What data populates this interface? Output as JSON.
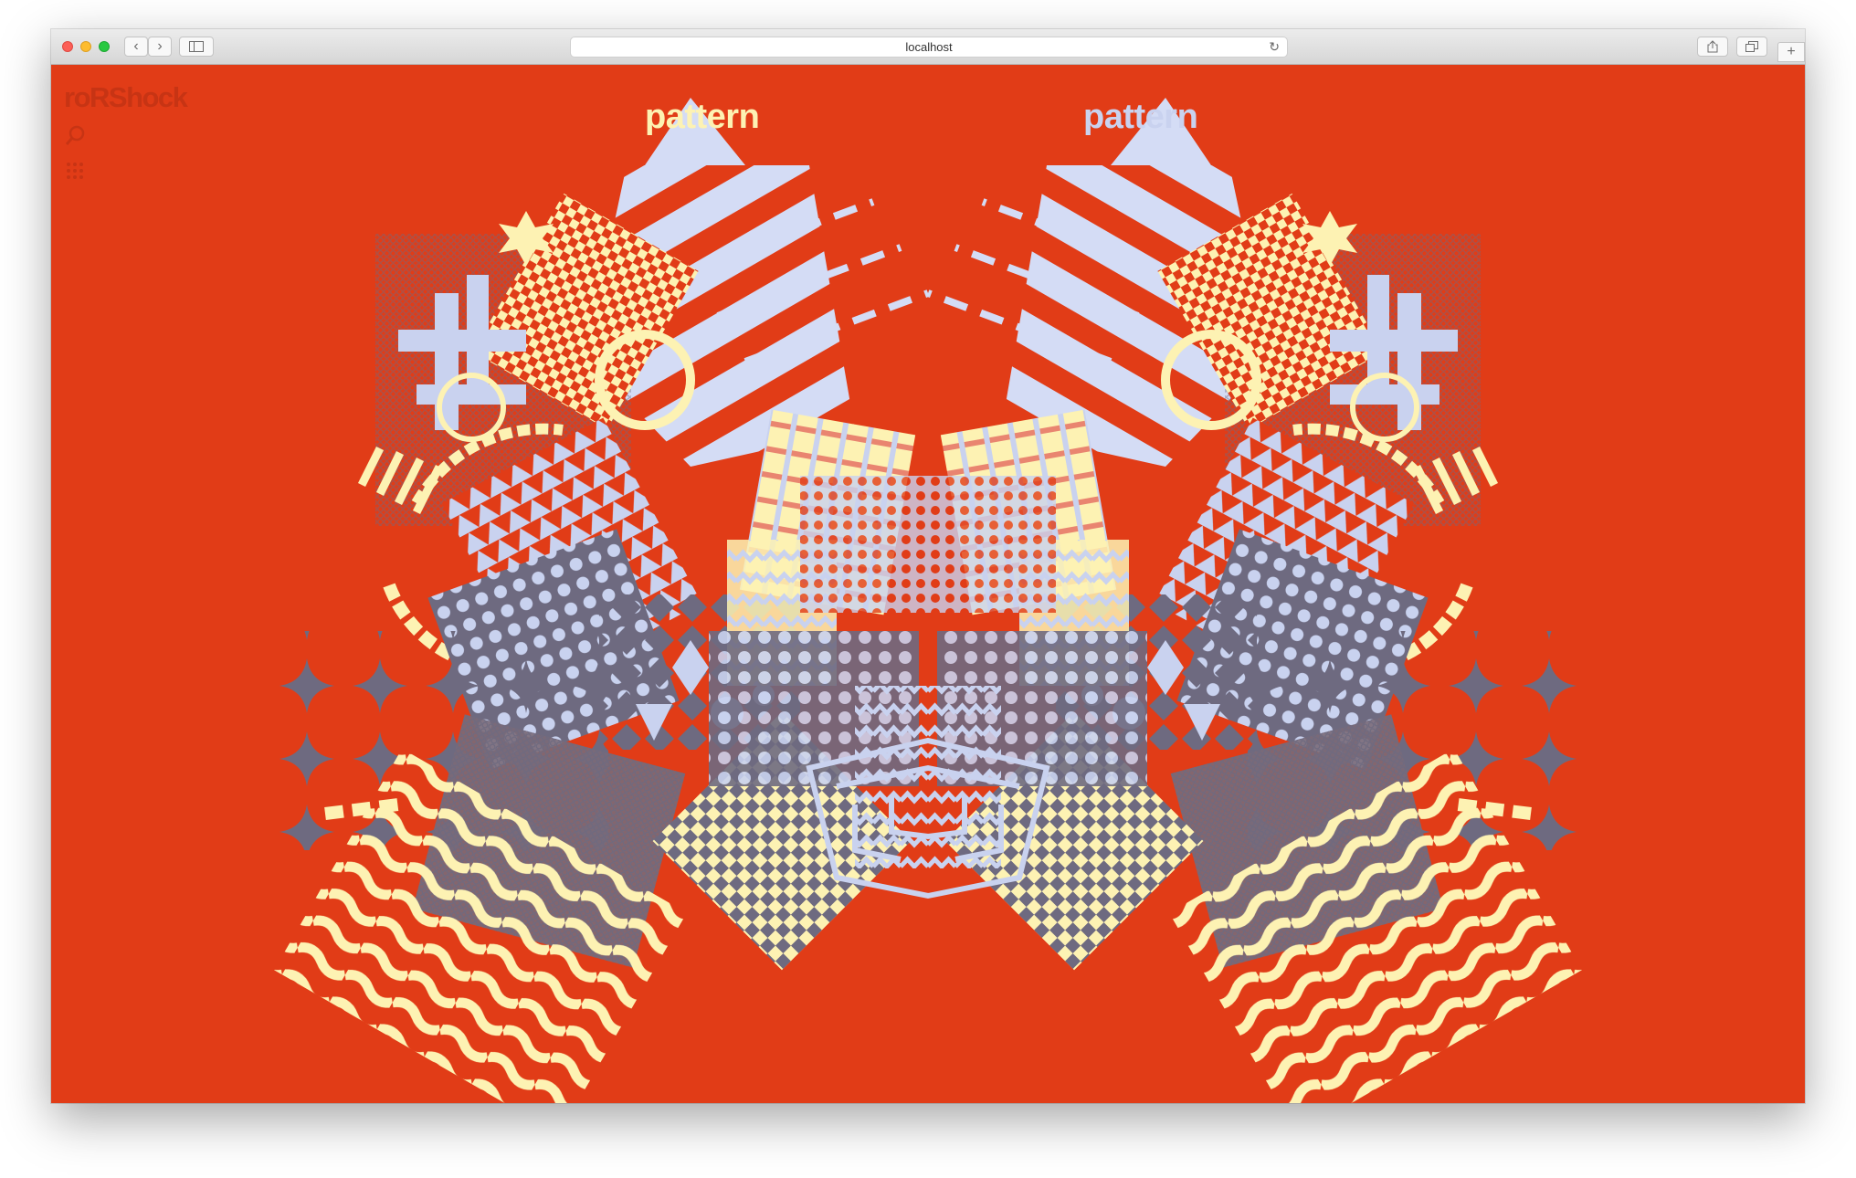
{
  "browser": {
    "url": "localhost",
    "traffic_lights": [
      "#fc5f57",
      "#fdbc2e",
      "#28c840"
    ]
  },
  "page": {
    "logo": "roRShock",
    "search_icon": "search-icon",
    "menu_icon": "grid-menu-icon",
    "title_left": "pattern",
    "title_right": "pattern"
  },
  "colors": {
    "background": "#e13c17",
    "cream": "#fdf2b3",
    "lavender": "#c9d2ef",
    "slate": "#6e6a80",
    "logo": "#c73414"
  }
}
